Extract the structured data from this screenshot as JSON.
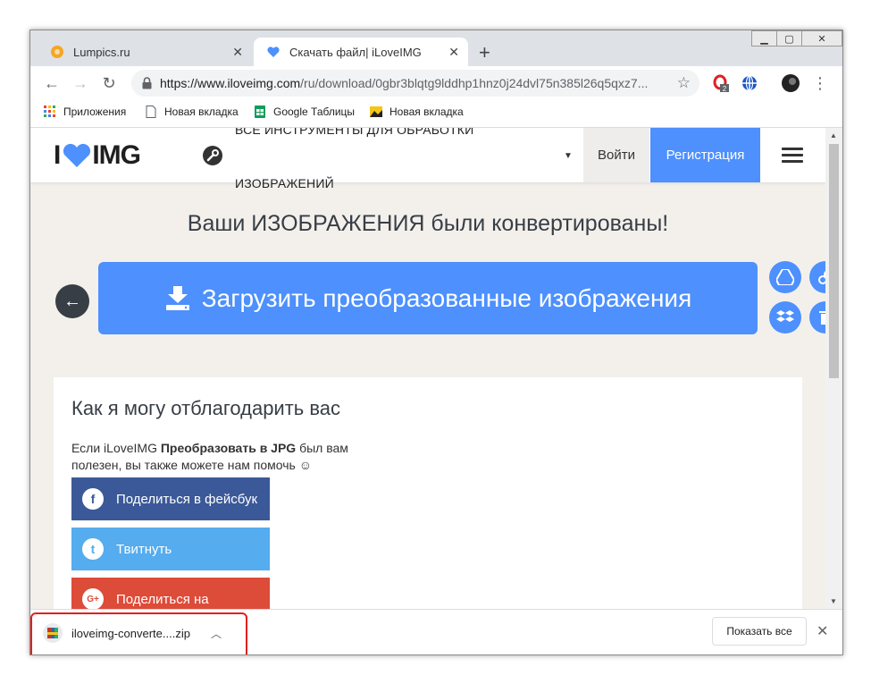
{
  "browser": {
    "tabs": [
      {
        "title": "Lumpics.ru",
        "active": false
      },
      {
        "title": "Скачать файл| iLoveIMG",
        "active": true
      }
    ],
    "url_host": "https://www.iloveimg.com",
    "url_path": "/ru/download/0gbr3blqtg9lddhp1hnz0j24dvl75n385l26q5qxz7...",
    "extension_badge": "2",
    "bookmarks": [
      "Приложения",
      "Новая вкладка",
      "Google Таблицы",
      "Новая вкладка"
    ]
  },
  "site": {
    "logo_left": "I",
    "logo_right": "IMG",
    "tools_label_line1": "ВСЕ ИНСТРУМЕНТЫ ДЛЯ ОБРАБОТКИ",
    "tools_label_line2": "ИЗОБРАЖЕНИЙ",
    "login": "Войти",
    "register": "Регистрация",
    "title": "Ваши ИЗОБРАЖЕНИЯ были конвертированы!",
    "download_button": "Загрузить преобразованные изображения",
    "thanks_heading": "Как я могу отблагодарить вас",
    "thanks_text_prefix": "Если iLoveIMG ",
    "thanks_text_bold": "Преобразовать в JPG",
    "thanks_text_suffix": " был вам полезен, вы также можете нам помочь ☺",
    "share_buttons": [
      {
        "label": "Поделиться в фейсбук",
        "color": "#3b5998",
        "icon": "f"
      },
      {
        "label": "Твитнуть",
        "color": "#55acee",
        "icon": "t"
      },
      {
        "label": "Поделиться на",
        "color": "#dd4b39",
        "icon": "G+"
      }
    ]
  },
  "download_shelf": {
    "filename": "iloveimg-converte....zip",
    "show_all": "Показать все"
  },
  "colors": {
    "accent": "#4d90fe",
    "highlight": "#e02020"
  }
}
